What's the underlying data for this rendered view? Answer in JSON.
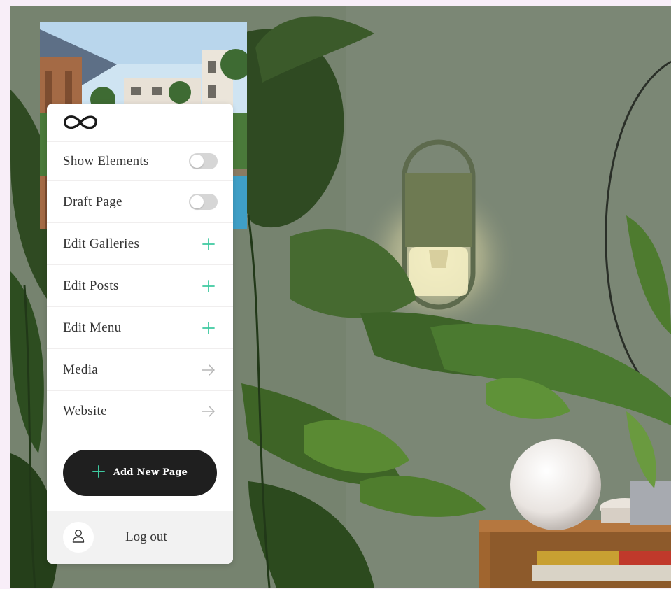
{
  "menu": {
    "items": [
      {
        "label": "Show Elements",
        "control": "toggle",
        "on": false
      },
      {
        "label": "Draft Page",
        "control": "toggle",
        "on": false
      },
      {
        "label": "Edit Galleries",
        "control": "plus"
      },
      {
        "label": "Edit Posts",
        "control": "plus"
      },
      {
        "label": "Edit Menu",
        "control": "plus"
      },
      {
        "label": "Media",
        "control": "arrow"
      },
      {
        "label": "Website",
        "control": "arrow"
      }
    ],
    "add_button_label": "Add New Page",
    "logout_label": "Log out"
  },
  "icons": {
    "logo": "infinity-logo-icon",
    "toggle": "toggle-switch",
    "plus": "plus-icon",
    "arrow": "arrow-right-icon",
    "user": "user-icon"
  },
  "colors": {
    "accent": "#3ec9a0",
    "button_bg": "#1f1f1f",
    "toggle_off": "#d6d6d6",
    "footer_bg": "#f2f2f2",
    "arrow": "#b5b5b5"
  }
}
